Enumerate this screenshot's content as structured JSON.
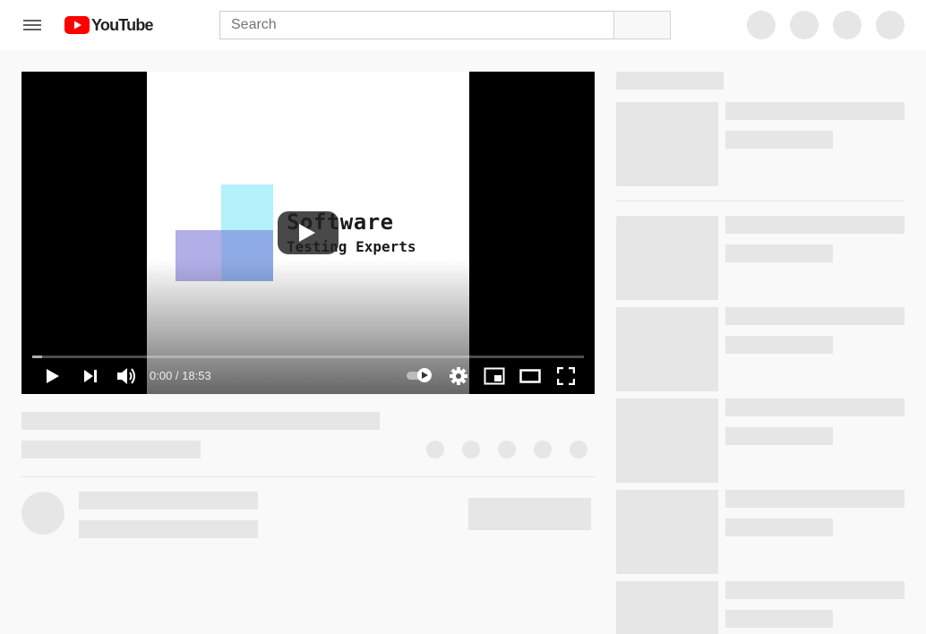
{
  "header": {
    "logo_text": "YouTube",
    "search_placeholder": "Search",
    "brand_color": "#ff0000"
  },
  "player": {
    "thumbnail": {
      "title_line1": "Software",
      "title_line2": "Testing Experts"
    },
    "time_display": "0:00 / 18:53",
    "progress_fraction": 0,
    "buffer_fraction": 0.018
  },
  "icons": {
    "menu": "hamburger-menu-icon",
    "play": "play-icon",
    "next": "next-icon",
    "volume": "volume-icon",
    "autoplay": "autoplay-toggle-icon",
    "settings": "gear-icon",
    "miniplayer": "miniplayer-icon",
    "theater": "theater-mode-icon",
    "fullscreen": "fullscreen-icon"
  },
  "colors": {
    "placeholder": "#e6e6e6",
    "background": "#f9f9f9"
  }
}
